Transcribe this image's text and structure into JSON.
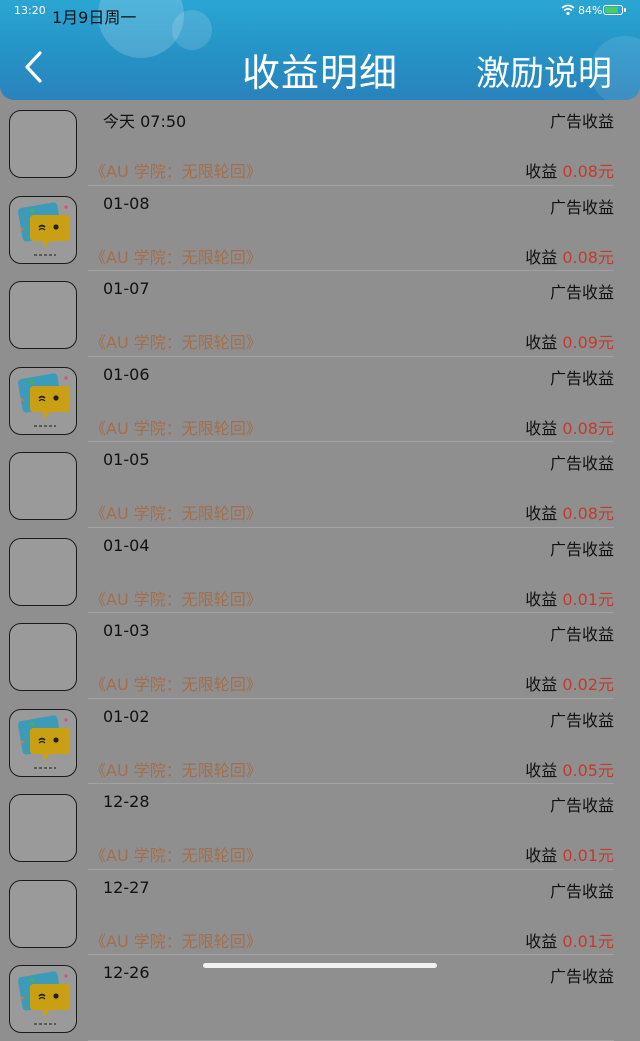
{
  "status_bar": {
    "time": "13:20",
    "date": "1月9日周一",
    "battery": "84%"
  },
  "header": {
    "title": "收益明细",
    "right_link": "激励说明"
  },
  "rows": [
    {
      "date": "今天 07:50",
      "type": "广告收益",
      "source": "《AU 学院：无限轮回》",
      "income_label": "收益",
      "amount": "0.08元",
      "avatar": "blank"
    },
    {
      "date": "01-08",
      "type": "广告收益",
      "source": "《AU 学院：无限轮回》",
      "income_label": "收益",
      "amount": "0.08元",
      "avatar": "emoji"
    },
    {
      "date": "01-07",
      "type": "广告收益",
      "source": "《AU 学院：无限轮回》",
      "income_label": "收益",
      "amount": "0.09元",
      "avatar": "blank"
    },
    {
      "date": "01-06",
      "type": "广告收益",
      "source": "《AU 学院：无限轮回》",
      "income_label": "收益",
      "amount": "0.08元",
      "avatar": "emoji"
    },
    {
      "date": "01-05",
      "type": "广告收益",
      "source": "《AU 学院：无限轮回》",
      "income_label": "收益",
      "amount": "0.08元",
      "avatar": "blank"
    },
    {
      "date": "01-04",
      "type": "广告收益",
      "source": "《AU 学院：无限轮回》",
      "income_label": "收益",
      "amount": "0.01元",
      "avatar": "blank"
    },
    {
      "date": "01-03",
      "type": "广告收益",
      "source": "《AU 学院：无限轮回》",
      "income_label": "收益",
      "amount": "0.02元",
      "avatar": "blank"
    },
    {
      "date": "01-02",
      "type": "广告收益",
      "source": "《AU 学院：无限轮回》",
      "income_label": "收益",
      "amount": "0.05元",
      "avatar": "emoji"
    },
    {
      "date": "12-28",
      "type": "广告收益",
      "source": "《AU 学院：无限轮回》",
      "income_label": "收益",
      "amount": "0.01元",
      "avatar": "blank"
    },
    {
      "date": "12-27",
      "type": "广告收益",
      "source": "《AU 学院：无限轮回》",
      "income_label": "收益",
      "amount": "0.01元",
      "avatar": "blank"
    },
    {
      "date": "12-26",
      "type": "广告收益",
      "source": "",
      "income_label": "",
      "amount": "",
      "avatar": "emoji"
    }
  ],
  "colors": {
    "header": "#2592c6",
    "background": "#8f8f8f",
    "amount": "#c53a2a",
    "source": "#a46e4a"
  },
  "icons": {
    "back": "chevron-left-icon",
    "wifi": "wifi-icon",
    "battery": "battery-charging-icon",
    "avatar_emoji": "wink-chat-bubble-icon"
  }
}
